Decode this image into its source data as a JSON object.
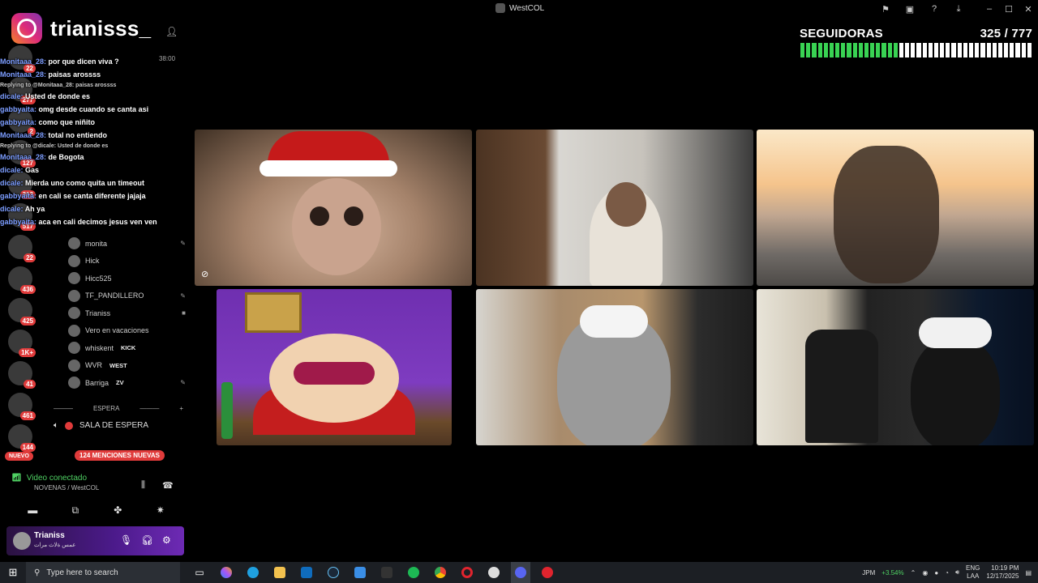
{
  "window": {
    "title": "WestCOL",
    "icons": [
      "flag-icon",
      "cast-icon",
      "help-icon",
      "download-icon"
    ],
    "controls": [
      "–",
      "☐",
      "✕"
    ]
  },
  "followers": {
    "label": "SEGUIDORAS",
    "current": 325,
    "goal": 777,
    "count_text": "325 / 777",
    "progress": 0.42
  },
  "instagram": {
    "handle": "trianisss_"
  },
  "chat": {
    "time": "38:00",
    "lines": [
      {
        "type": "msg",
        "user": "Monitaaa_28:",
        "text": "por que dicen viva ?"
      },
      {
        "type": "msg",
        "user": "Monitaaa_28:",
        "text": "paisas arossss"
      },
      {
        "type": "reply",
        "text": "Replying to @Monitaaa_28: paisas arossss"
      },
      {
        "type": "msg",
        "user": "dicale:",
        "text": "Usted de donde es"
      },
      {
        "type": "msg",
        "user": "gabbyaita:",
        "text": "omg desde cuando se canta asi"
      },
      {
        "type": "msg",
        "user": "gabbyaita:",
        "text": "como que niñito"
      },
      {
        "type": "msg",
        "user": "Monitaaa_28:",
        "text": "total no entiendo"
      },
      {
        "type": "reply",
        "text": "Replying to @dicale: Usted de donde es"
      },
      {
        "type": "msg",
        "user": "Monitaaa_28:",
        "text": "de Bogota"
      },
      {
        "type": "msg",
        "user": "dicale:",
        "text": "Gas"
      },
      {
        "type": "msg",
        "user": "dicale:",
        "text": "Mierda uno como quita un timeout"
      },
      {
        "type": "msg",
        "user": "gabbyaita:",
        "text": "en cali se canta diferente jajaja"
      },
      {
        "type": "msg",
        "user": "dicale:",
        "text": "Ah ya"
      },
      {
        "type": "msg",
        "user": "gabbyaita:",
        "text": "aca en cali decimos jesus ven ven"
      }
    ]
  },
  "servers": [
    {
      "badge": "22"
    },
    {
      "badge": "277"
    },
    {
      "badge": "2"
    },
    {
      "badge": "127"
    },
    {
      "badge": "313"
    },
    {
      "badge": "517"
    },
    {
      "badge": "22"
    },
    {
      "badge": "436"
    },
    {
      "badge": "425"
    },
    {
      "badge": "1K+"
    },
    {
      "badge": "41"
    },
    {
      "badge": "461"
    },
    {
      "badge": "144"
    }
  ],
  "members": [
    {
      "name": "monita",
      "tag": "",
      "icon": "✎"
    },
    {
      "name": "Hick",
      "tag": "",
      "icon": ""
    },
    {
      "name": "Hicc525",
      "tag": "",
      "icon": ""
    },
    {
      "name": "TF_PANDILLERO",
      "tag": "",
      "icon": "✎"
    },
    {
      "name": "Trianiss",
      "tag": "",
      "icon": "■"
    },
    {
      "name": "Vero en vacaciones",
      "tag": "",
      "icon": ""
    },
    {
      "name": "whiskent",
      "tag": "KICK",
      "icon": ""
    },
    {
      "name": "WVR",
      "tag": "WEST",
      "icon": ""
    },
    {
      "name": "Barriga",
      "tag": "ZV",
      "icon": "✎"
    }
  ],
  "channels": {
    "espera_header": "ESPERA",
    "sala": "SALA DE ESPERA",
    "nuevo": "NUEVO",
    "menciones": "124 MENCIONES NUEVAS"
  },
  "voice": {
    "status": "Video conectado",
    "channel": "NOVENAS / WestCOL"
  },
  "user_panel": {
    "name": "Trianiss",
    "status": "عمس ةلاث مرات"
  },
  "taskbar": {
    "search_placeholder": "Type here to search",
    "stock": "JPM",
    "stock_change": "+3.54%",
    "lang1": "ENG",
    "lang2": "LAA",
    "time": "10:19 PM",
    "date": "12/17/2025"
  }
}
